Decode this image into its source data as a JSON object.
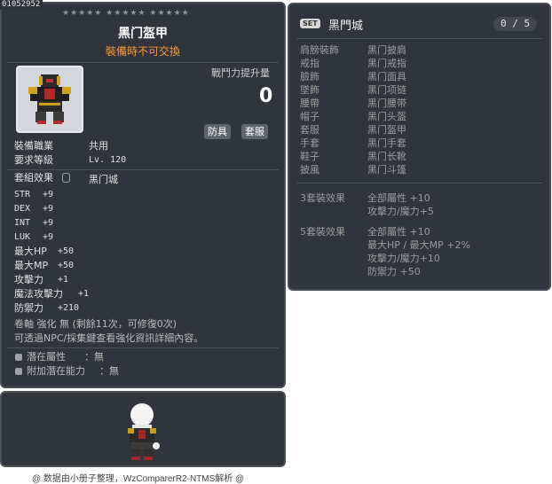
{
  "item_id": "01052952",
  "stars": "★★★★★  ★★★★★  ★★★★★",
  "item": {
    "name": "黑门盔甲",
    "trade_note": "裝備時不可交換",
    "power_label": "戰鬥力提升量",
    "power_value": "0",
    "tags": [
      "防具",
      "套服"
    ],
    "job_label": "裝備職業",
    "job_value": "共用",
    "level_label": "要求等級",
    "level_value": "Lv. 120",
    "set_effect_label": "套組效果",
    "set_name": "黑门城",
    "stats": [
      {
        "label": "STR",
        "value": "+9"
      },
      {
        "label": "DEX",
        "value": "+9"
      },
      {
        "label": "INT",
        "value": "+9"
      },
      {
        "label": "LUK",
        "value": "+9"
      },
      {
        "label": "最大HP",
        "value": "+50"
      },
      {
        "label": "最大MP",
        "value": "+50"
      },
      {
        "label": "攻擊力",
        "value": "+1"
      },
      {
        "label": "魔法攻擊力",
        "value": "+1"
      },
      {
        "label": "防禦力",
        "value": "+210"
      }
    ],
    "scroll_line": "卷軸 強化 無 (剩餘11次，可修復0次)",
    "info_line": "可透過NPC/採集鍵查看強化資訊詳細內容。",
    "potential_label": "潛在屬性",
    "potential_value": "：無",
    "bonus_potential_label": "附加潛在能力",
    "bonus_potential_value": "：無"
  },
  "set": {
    "badge": "SET",
    "name": "黑門城",
    "count": "0 / 5",
    "pieces": [
      {
        "slot": "肩膀裝飾",
        "name": "黑门披肩"
      },
      {
        "slot": "戒指",
        "name": "黑门戒指"
      },
      {
        "slot": "臉飾",
        "name": "黑门面具"
      },
      {
        "slot": "墜飾",
        "name": "黑门项链"
      },
      {
        "slot": "腰帶",
        "name": "黑门腰带"
      },
      {
        "slot": "帽子",
        "name": "黑门头盔"
      },
      {
        "slot": "套服",
        "name": "黑门盔甲"
      },
      {
        "slot": "手套",
        "name": "黑门手套"
      },
      {
        "slot": "鞋子",
        "name": "黑门长靴"
      },
      {
        "slot": "披風",
        "name": "黑门斗篷"
      }
    ],
    "effect3_label": "3套裝效果",
    "effect3": [
      "全部屬性 +10",
      "攻擊力/魔力+5"
    ],
    "effect5_label": "5套裝效果",
    "effect5": [
      "全部屬性 +10",
      "最大HP / 最大MP  +2%",
      "攻擊力/魔力+10",
      "防禦力 +50"
    ]
  },
  "footer": "@ 数据由小册子整理，WzComparerR2-NTMS解析 @"
}
